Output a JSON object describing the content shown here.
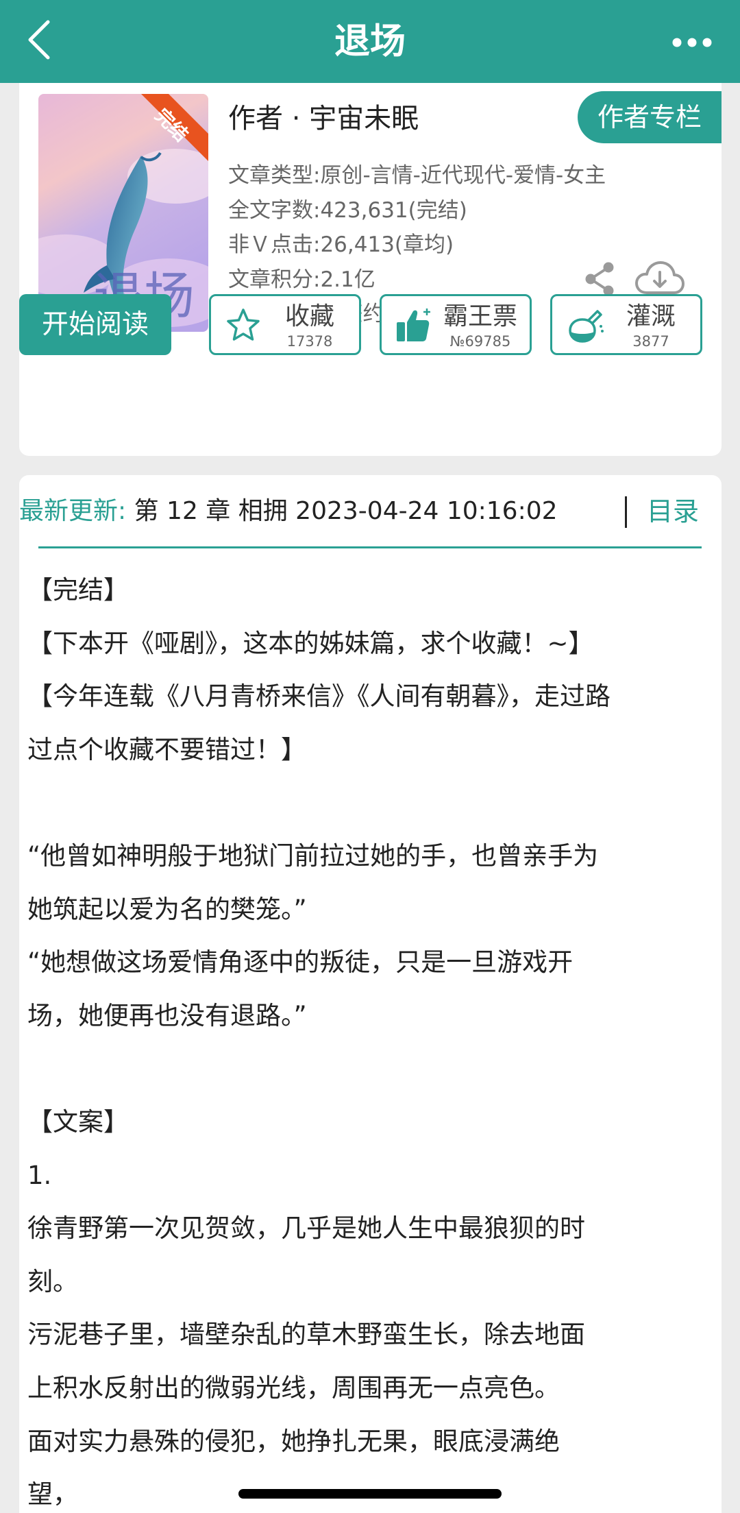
{
  "header": {
    "title": "退场"
  },
  "book": {
    "cover_title_text": "退场",
    "status_ribbon": "完结",
    "author": "作者 · 宇宙未眠",
    "author_column_button": "作者专栏",
    "meta": [
      "文章类型:原创-言情-近代现代-爱情-女主",
      "全文字数:423,631(完结)",
      "非Ｖ点击:26,413(章均)",
      "文章积分:2.1亿",
      "签约状态:已签约"
    ]
  },
  "actions": {
    "read_label": "开始阅读",
    "favorite": {
      "label": "收藏",
      "count": "17378"
    },
    "vote": {
      "label": "霸王票",
      "count": "№69785"
    },
    "water": {
      "label": "灌溉",
      "count": "3877"
    }
  },
  "update": {
    "label": "最新更新:",
    "text": "第 12 章 相拥 2023-04-24 10:16:02",
    "toc_label": "目录"
  },
  "description": [
    "【完结】",
    "【下本开《哑剧》，这本的姊妹篇，求个收藏！~】",
    "【今年连载《八月青桥来信》《人间有朝暮》，走过路",
    "过点个收藏不要错过！】",
    "",
    "“他曾如神明般于地狱门前拉过她的手，也曾亲手为",
    "她筑起以爱为名的樊笼。”",
    "“她想做这场爱情角逐中的叛徒，只是一旦游戏开",
    "场，她便再也没有退路。”",
    "",
    "【文案】",
    "1.",
    "徐青野第一次见贺敛，几乎是她人生中最狼狈的时",
    "刻。",
    "污泥巷子里，墙壁杂乱的草木野蛮生长，除去地面",
    "上积水反射出的微弱光线，周围再无一点亮色。",
    "面对实力悬殊的侵犯，她挣扎无果，眼底浸满绝",
    "望，"
  ],
  "colors": {
    "accent": "#2aa093",
    "ribbon": "#e8531f"
  }
}
